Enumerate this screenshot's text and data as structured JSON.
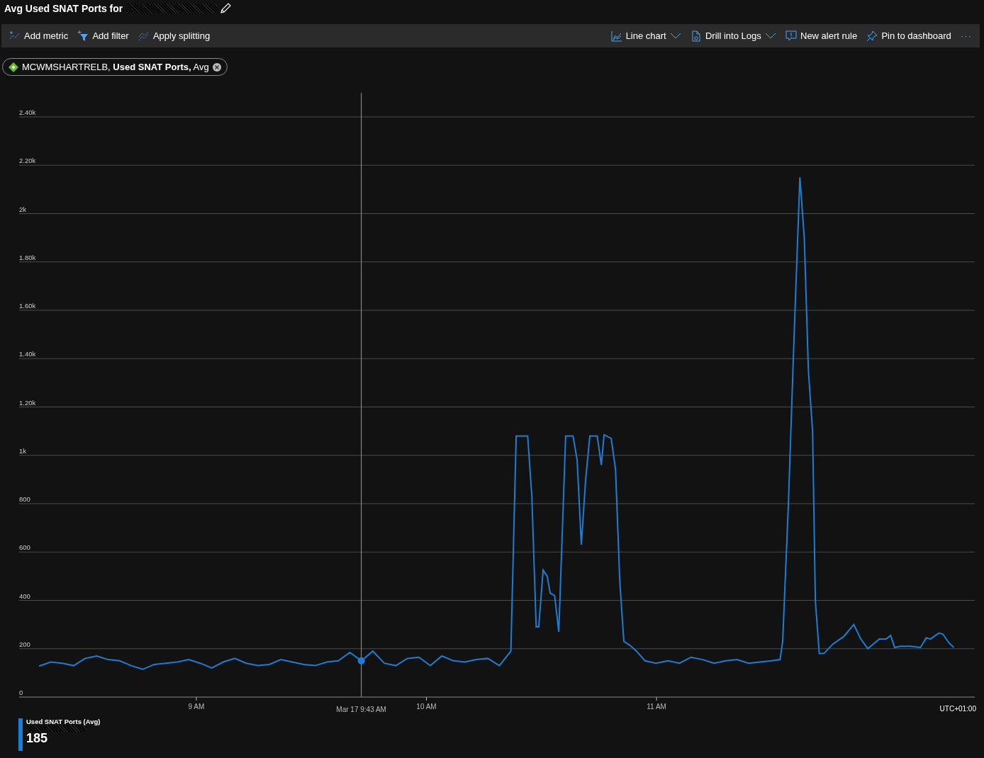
{
  "title": "Avg Used SNAT Ports for",
  "toolbar": {
    "left": [
      {
        "kind": "metric",
        "label": "Add metric"
      },
      {
        "kind": "filter",
        "label": "Add filter"
      },
      {
        "kind": "split",
        "label": "Apply splitting"
      }
    ],
    "right": [
      {
        "kind": "chart",
        "label": "Line chart",
        "dropdown": true
      },
      {
        "kind": "logs",
        "label": "Drill into Logs",
        "dropdown": true
      },
      {
        "kind": "alert",
        "label": "New alert rule",
        "dropdown": false
      },
      {
        "kind": "pin",
        "label": "Pin to dashboard",
        "dropdown": false
      }
    ],
    "more": "···"
  },
  "metric_chip": {
    "text": "MCWMSHARTRELB, **Used SNAT Ports,** Avg"
  },
  "chart": {
    "chart_data": {
      "type": "line",
      "xlim": [
        8.23,
        12.383
      ],
      "ylim": [
        0,
        2400
      ],
      "xticks": [
        {
          "value": 9,
          "label": "9 AM"
        },
        {
          "value": 10,
          "label": "10 AM"
        },
        {
          "value": 11,
          "label": "11 AM"
        }
      ],
      "yticks": [
        {
          "value": 0,
          "label": "0"
        },
        {
          "value": 200,
          "label": "200"
        },
        {
          "value": 400,
          "label": "400"
        },
        {
          "value": 600,
          "label": "600"
        },
        {
          "value": 800,
          "label": "800"
        },
        {
          "value": 1000,
          "label": "1k"
        },
        {
          "value": 1200,
          "label": "1.20k"
        },
        {
          "value": 1400,
          "label": "1.40k"
        },
        {
          "value": 1600,
          "label": "1.60k"
        },
        {
          "value": 1800,
          "label": "1.80k"
        },
        {
          "value": 2000,
          "label": "2k"
        },
        {
          "value": 2200,
          "label": "2.20k"
        },
        {
          "value": 2400,
          "label": "2.40k"
        }
      ],
      "x": [
        8.317,
        8.367,
        8.417,
        8.467,
        8.517,
        8.567,
        8.617,
        8.667,
        8.717,
        8.767,
        8.817,
        8.867,
        8.917,
        8.967,
        9.017,
        9.067,
        9.117,
        9.167,
        9.217,
        9.267,
        9.317,
        9.367,
        9.417,
        9.467,
        9.517,
        9.567,
        9.617,
        9.667,
        9.717,
        9.767,
        9.817,
        9.867,
        9.917,
        9.967,
        10.017,
        10.067,
        10.117,
        10.167,
        10.217,
        10.267,
        10.317,
        10.367,
        10.39,
        10.44,
        10.458,
        10.477,
        10.488,
        10.507,
        10.525,
        10.538,
        10.557,
        10.575,
        10.605,
        10.637,
        10.655,
        10.673,
        10.692,
        10.71,
        10.742,
        10.76,
        10.772,
        10.803,
        10.822,
        10.84,
        10.858,
        10.883,
        10.913,
        10.95,
        10.997,
        11.05,
        11.1,
        11.15,
        11.2,
        11.25,
        11.3,
        11.35,
        11.4,
        11.45,
        11.5,
        11.537,
        11.548,
        11.573,
        11.598,
        11.623,
        11.642,
        11.66,
        11.678,
        11.69,
        11.707,
        11.727,
        11.767,
        11.813,
        11.857,
        11.888,
        11.918,
        11.968,
        11.998,
        12.017,
        12.035,
        12.06,
        12.103,
        12.147,
        12.172,
        12.19,
        12.227,
        12.245,
        12.27,
        12.292
      ],
      "series": [
        {
          "name": "Used SNAT Ports (Avg)",
          "color": "#1a7fd4",
          "values": [
            128,
            145,
            140,
            130,
            160,
            170,
            155,
            150,
            130,
            115,
            135,
            140,
            145,
            155,
            140,
            120,
            145,
            160,
            140,
            130,
            135,
            155,
            145,
            135,
            130,
            145,
            150,
            185,
            150,
            190,
            140,
            130,
            160,
            165,
            130,
            170,
            150,
            145,
            155,
            160,
            130,
            190,
            1080,
            1080,
            830,
            290,
            290,
            525,
            500,
            430,
            420,
            270,
            1080,
            1080,
            980,
            630,
            900,
            1080,
            1080,
            960,
            1085,
            1070,
            940,
            480,
            230,
            215,
            190,
            150,
            140,
            150,
            140,
            165,
            155,
            140,
            150,
            155,
            140,
            145,
            150,
            155,
            230,
            800,
            1500,
            2150,
            1900,
            1350,
            1100,
            400,
            180,
            180,
            220,
            250,
            300,
            240,
            200,
            240,
            240,
            255,
            205,
            210,
            210,
            205,
            245,
            240,
            265,
            260,
            225,
            205
          ]
        }
      ],
      "annotations": [
        {
          "x": 9.717,
          "text": "Mar 17 9:43 AM"
        }
      ],
      "grid": "y"
    },
    "timezone": "UTC+01:00"
  },
  "legend": {
    "value": "185"
  }
}
